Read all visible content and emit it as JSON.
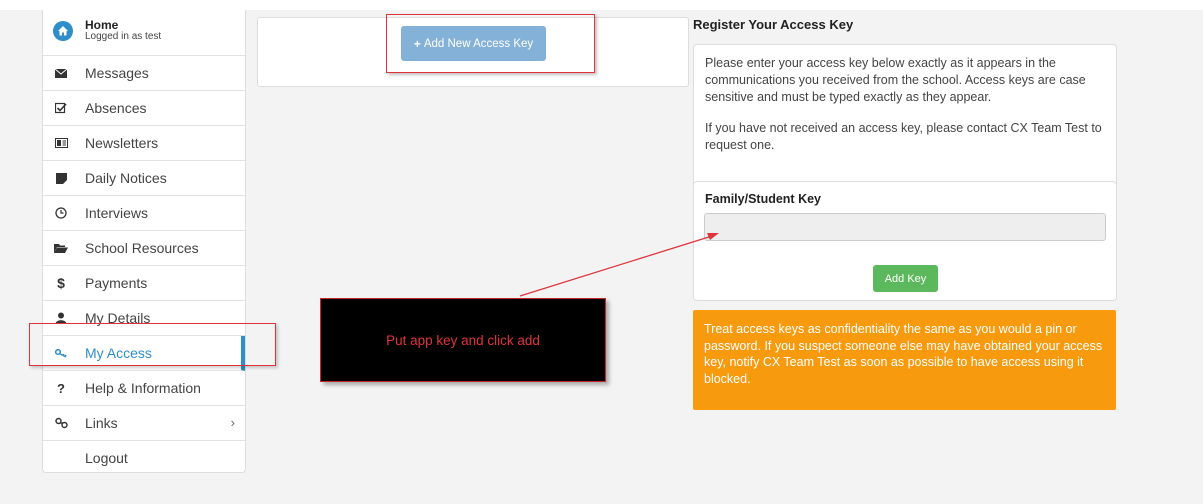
{
  "sidebar": {
    "home_title": "Home",
    "home_subtitle": "Logged in as test",
    "items": [
      {
        "label": "Messages",
        "icon": "envelope-icon"
      },
      {
        "label": "Absences",
        "icon": "check-square-icon"
      },
      {
        "label": "Newsletters",
        "icon": "newspaper-icon"
      },
      {
        "label": "Daily Notices",
        "icon": "sticky-note-icon"
      },
      {
        "label": "Interviews",
        "icon": "clock-icon"
      },
      {
        "label": "School Resources",
        "icon": "folder-open-icon"
      },
      {
        "label": "Payments",
        "icon": "dollar-icon"
      },
      {
        "label": "My Details",
        "icon": "user-icon"
      },
      {
        "label": "My Access",
        "icon": "key-icon",
        "active": true
      },
      {
        "label": "Help & Information",
        "icon": "question-icon"
      },
      {
        "label": "Links",
        "icon": "link-icon",
        "chevron": "›"
      },
      {
        "label": "Logout",
        "icon": ""
      }
    ]
  },
  "main": {
    "add_access_key_label": "Add New Access Key"
  },
  "register": {
    "title": "Register Your Access Key",
    "info_p1": "Please enter your access key below exactly as it appears in the communications you received from the school. Access keys are case sensitive and must be typed exactly as they appear.",
    "info_p2": "If you have not received an access key, please contact CX Team Test to request one.",
    "key_label": "Family/Student Key",
    "key_value": "",
    "add_key_label": "Add Key",
    "warning": "Treat access keys as confidentiality the same as you would a pin or password. If you suspect someone else may have obtained your access key, notify CX Team Test as soon as possible to have access using it blocked."
  },
  "annotation": {
    "callout_text": "Put app key and click add"
  },
  "colors": {
    "accent": "#2d8ec9",
    "add_button": "#84b1d8",
    "success": "#5cb85c",
    "warning": "#f79a0e",
    "annotation_red": "#e0343b"
  }
}
